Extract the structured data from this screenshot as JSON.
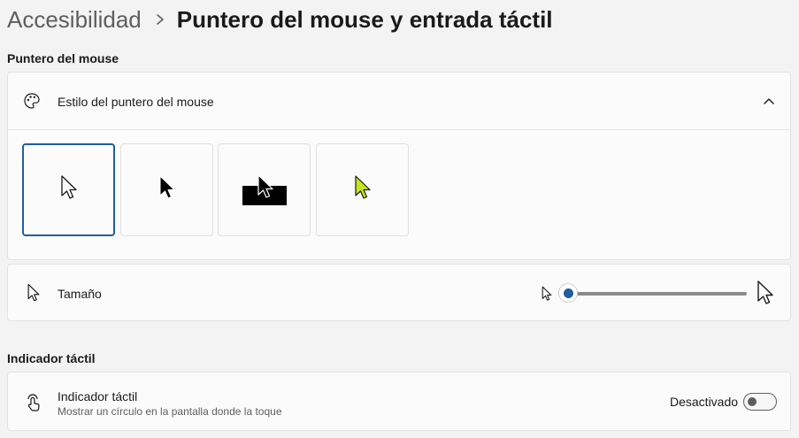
{
  "breadcrumb": {
    "parent": "Accesibilidad",
    "separator_icon": "chevron-right-icon",
    "current": "Puntero del mouse y entrada táctil"
  },
  "sections": {
    "mouse_pointer": "Puntero del mouse",
    "touch_indicator": "Indicador táctil"
  },
  "pointer_style": {
    "label": "Estilo del puntero del mouse",
    "icon": "palette-icon",
    "expanded": true,
    "options": [
      {
        "name": "Blanco",
        "icon": "white-cursor-icon",
        "selected": true
      },
      {
        "name": "Negro",
        "icon": "black-cursor-icon",
        "selected": false
      },
      {
        "name": "Invertido",
        "icon": "inverted-cursor-icon",
        "selected": false
      },
      {
        "name": "Personalizado",
        "icon": "custom-cursor-icon",
        "color": "#c3e61e",
        "selected": false
      }
    ]
  },
  "size": {
    "label": "Tamaño",
    "icon": "cursor-icon",
    "slider_value": 1,
    "slider_min": 1,
    "slider_max": 15
  },
  "touch": {
    "label": "Indicador táctil",
    "description": "Mostrar un círculo en la pantalla donde la toque",
    "icon": "touch-icon",
    "state": "Desactivado",
    "enabled": false
  },
  "colors": {
    "accent": "#1f5e9e",
    "background": "#f3f3f3",
    "card": "#fbfbfb"
  }
}
